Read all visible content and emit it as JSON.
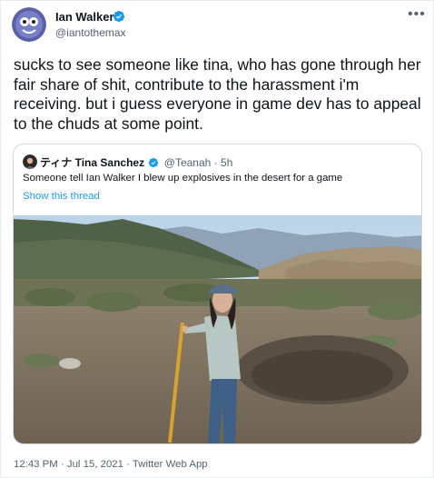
{
  "author": {
    "name": "Ian Walker",
    "handle": "@iantothemax",
    "verified": true
  },
  "tweet": {
    "text": "sucks to see someone like tina, who has gone through her fair share of shit, contribute to the harassment i'm receiving. but i guess everyone in game dev has to appeal to the chuds at some point."
  },
  "quoted_tweet": {
    "name": "ティナ Tina Sanchez",
    "handle": "@Teanah",
    "separator": "·",
    "time": "5h",
    "text": "Someone tell Ian Walker I blew up explosives in the desert for a game",
    "show_thread": "Show this thread"
  },
  "meta": {
    "time": "12:43 PM",
    "date": "Jul 15, 2021",
    "source": "Twitter Web App",
    "separator": "·"
  },
  "colors": {
    "accent": "#1d9bf0",
    "text": "#0f1419",
    "secondary": "#536471",
    "border": "#cfd9de"
  },
  "icons": [
    "avatar-icon",
    "verified-badge-icon",
    "more-options-icon"
  ]
}
